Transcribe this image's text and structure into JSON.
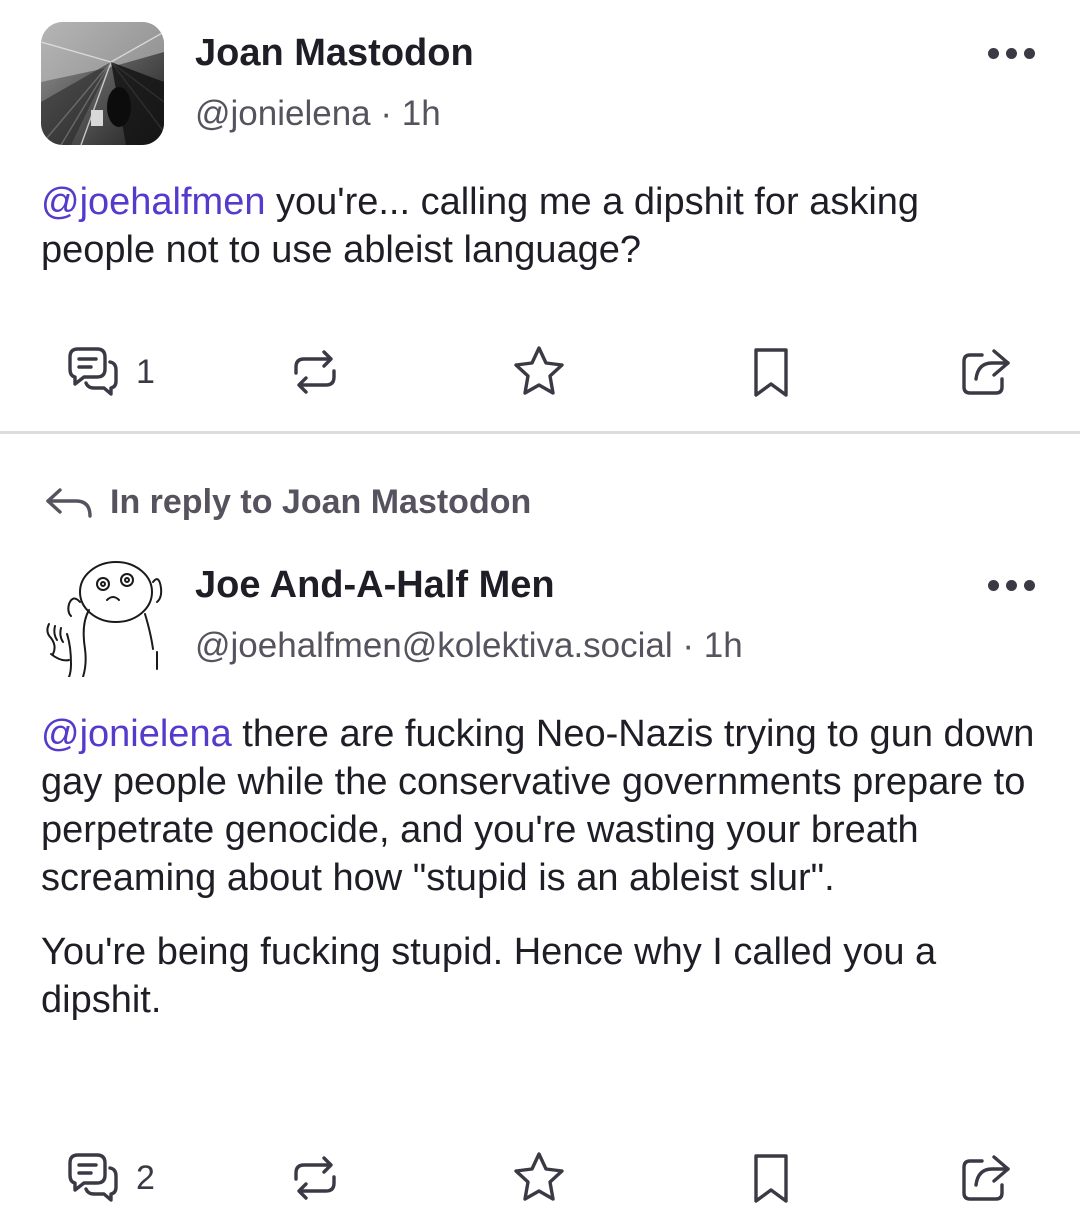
{
  "posts": [
    {
      "display_name": "Joan Mastodon",
      "handle": "@jonielena",
      "separator": "·",
      "time": "1h",
      "content": {
        "paragraphs": [
          {
            "mention": "@joehalfmen",
            "text": " you're... calling me a dipshit for asking people not to use ableist language?"
          }
        ]
      },
      "actions": {
        "reply_count": "1",
        "reply_icon": "reply-icon",
        "boost_icon": "boost-icon",
        "favourite_icon": "star-icon",
        "bookmark_icon": "bookmark-icon",
        "share_icon": "share-icon"
      }
    },
    {
      "reply_indicator": "In reply to Joan Mastodon",
      "display_name": "Joe And-A-Half Men",
      "handle": "@joehalfmen@kolektiva.social",
      "separator": "·",
      "time": "1h",
      "content": {
        "paragraphs": [
          {
            "mention": "@jonielena",
            "text": " there are fucking Neo-Nazis trying to gun down gay people while the conservative governments prepare to perpetrate genocide, and you're wasting your breath screaming about how \"stupid is an ableist slur\"."
          },
          {
            "mention": "",
            "text": "You're being fucking stupid. Hence why I called you a dipshit."
          }
        ]
      },
      "actions": {
        "reply_count": "2",
        "reply_icon": "reply-icon",
        "boost_icon": "boost-icon",
        "favourite_icon": "star-icon",
        "bookmark_icon": "bookmark-icon",
        "share_icon": "share-icon"
      }
    }
  ],
  "colors": {
    "accent": "#563acc",
    "text": "#1f1d26",
    "muted": "#56535f",
    "icon": "#3b3944",
    "divider": "#dcdbe0"
  }
}
